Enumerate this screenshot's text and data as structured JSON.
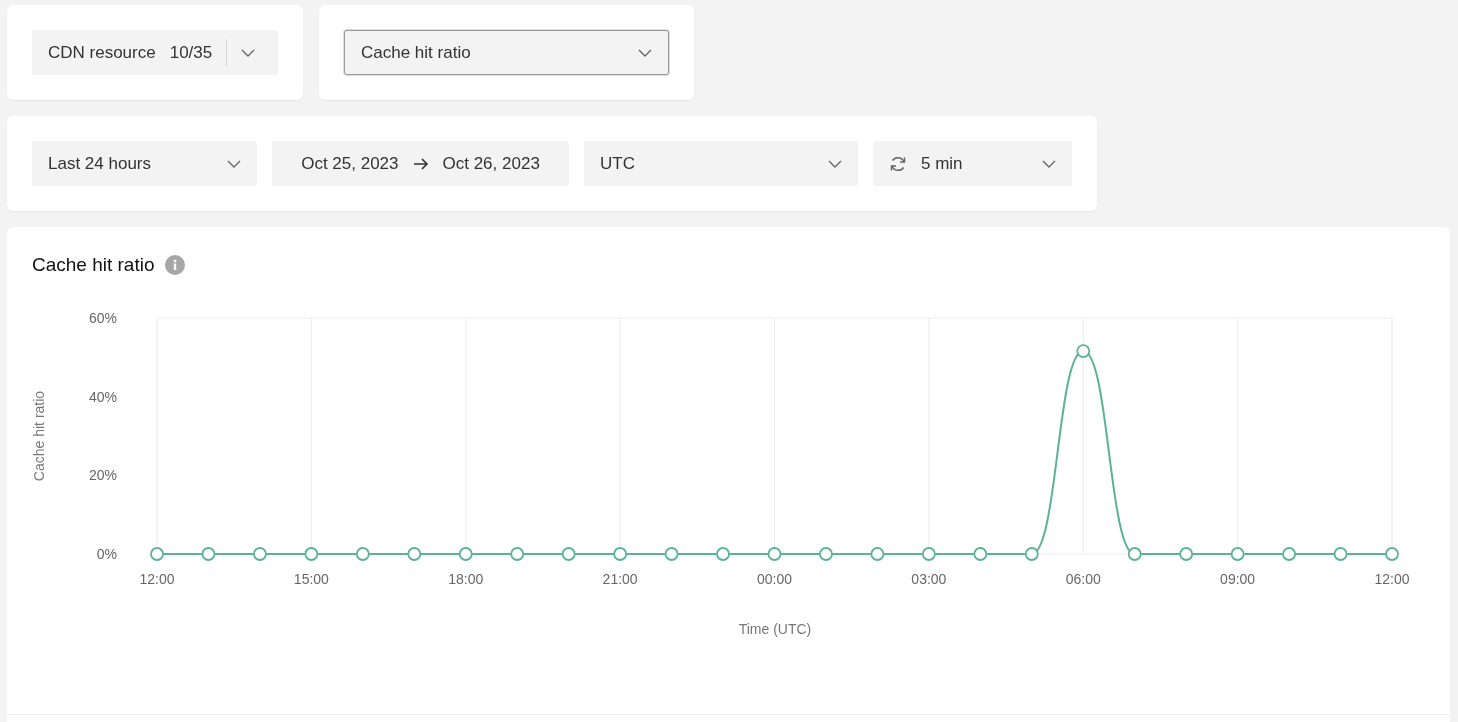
{
  "resource_filter": {
    "label": "CDN resource",
    "count": "10/35"
  },
  "metric_select": {
    "value": "Cache hit ratio"
  },
  "period_select": {
    "value": "Last 24 hours"
  },
  "date_range": {
    "start": "Oct 25, 2023",
    "end": "Oct 26, 2023"
  },
  "timezone_select": {
    "value": "UTC"
  },
  "refresh_select": {
    "value": "5 min"
  },
  "chart_panel": {
    "title": "Cache hit ratio",
    "chart_data": {
      "type": "line",
      "xlabel": "Time (UTC)",
      "ylabel": "Cache hit ratio",
      "categories": [
        "12:00",
        null,
        null,
        "15:00",
        null,
        null,
        "18:00",
        null,
        null,
        "21:00",
        null,
        null,
        "00:00",
        null,
        null,
        "03:00",
        null,
        null,
        "06:00",
        null,
        null,
        "09:00",
        null,
        null,
        "12:00"
      ],
      "grid": true,
      "series": [
        {
          "color": "#5bb393",
          "marker": true,
          "values": [
            0,
            0,
            0,
            0,
            0,
            0,
            0,
            0,
            0,
            0,
            0,
            0,
            0,
            0,
            0,
            0,
            0,
            0,
            51.6,
            0,
            0,
            0,
            0,
            0,
            0
          ]
        }
      ],
      "ylim": [
        0,
        60
      ],
      "yticks": [
        {
          "value": 0,
          "label": "0%"
        },
        {
          "value": 20,
          "label": "20%"
        },
        {
          "value": 40,
          "label": "40%"
        },
        {
          "value": 60,
          "label": "60%"
        }
      ]
    }
  }
}
